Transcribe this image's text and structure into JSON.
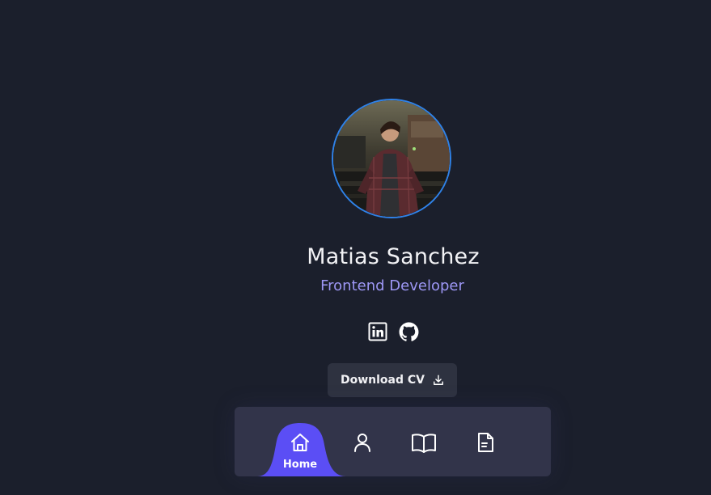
{
  "profile": {
    "name": "Matias Sanchez",
    "role": "Frontend Developer",
    "avatar_alt": "profile-photo"
  },
  "socials": [
    {
      "name": "LinkedIn",
      "icon": "linkedin-icon"
    },
    {
      "name": "GitHub",
      "icon": "github-icon"
    }
  ],
  "cv_button": {
    "label": "Download CV",
    "icon": "download-icon"
  },
  "nav": {
    "items": [
      {
        "label": "Home",
        "icon": "home-icon",
        "active": true
      },
      {
        "label": "About",
        "icon": "user-icon",
        "active": false
      },
      {
        "label": "Skills",
        "icon": "book-icon",
        "active": false
      },
      {
        "label": "CV",
        "icon": "document-icon",
        "active": false
      }
    ]
  },
  "colors": {
    "background": "#1b1f2c",
    "accent": "#5b4ef5",
    "role_text": "#9d97f5",
    "avatar_border": "#2f82e8",
    "nav_bg": "#32344a",
    "button_bg": "#2e3240"
  }
}
